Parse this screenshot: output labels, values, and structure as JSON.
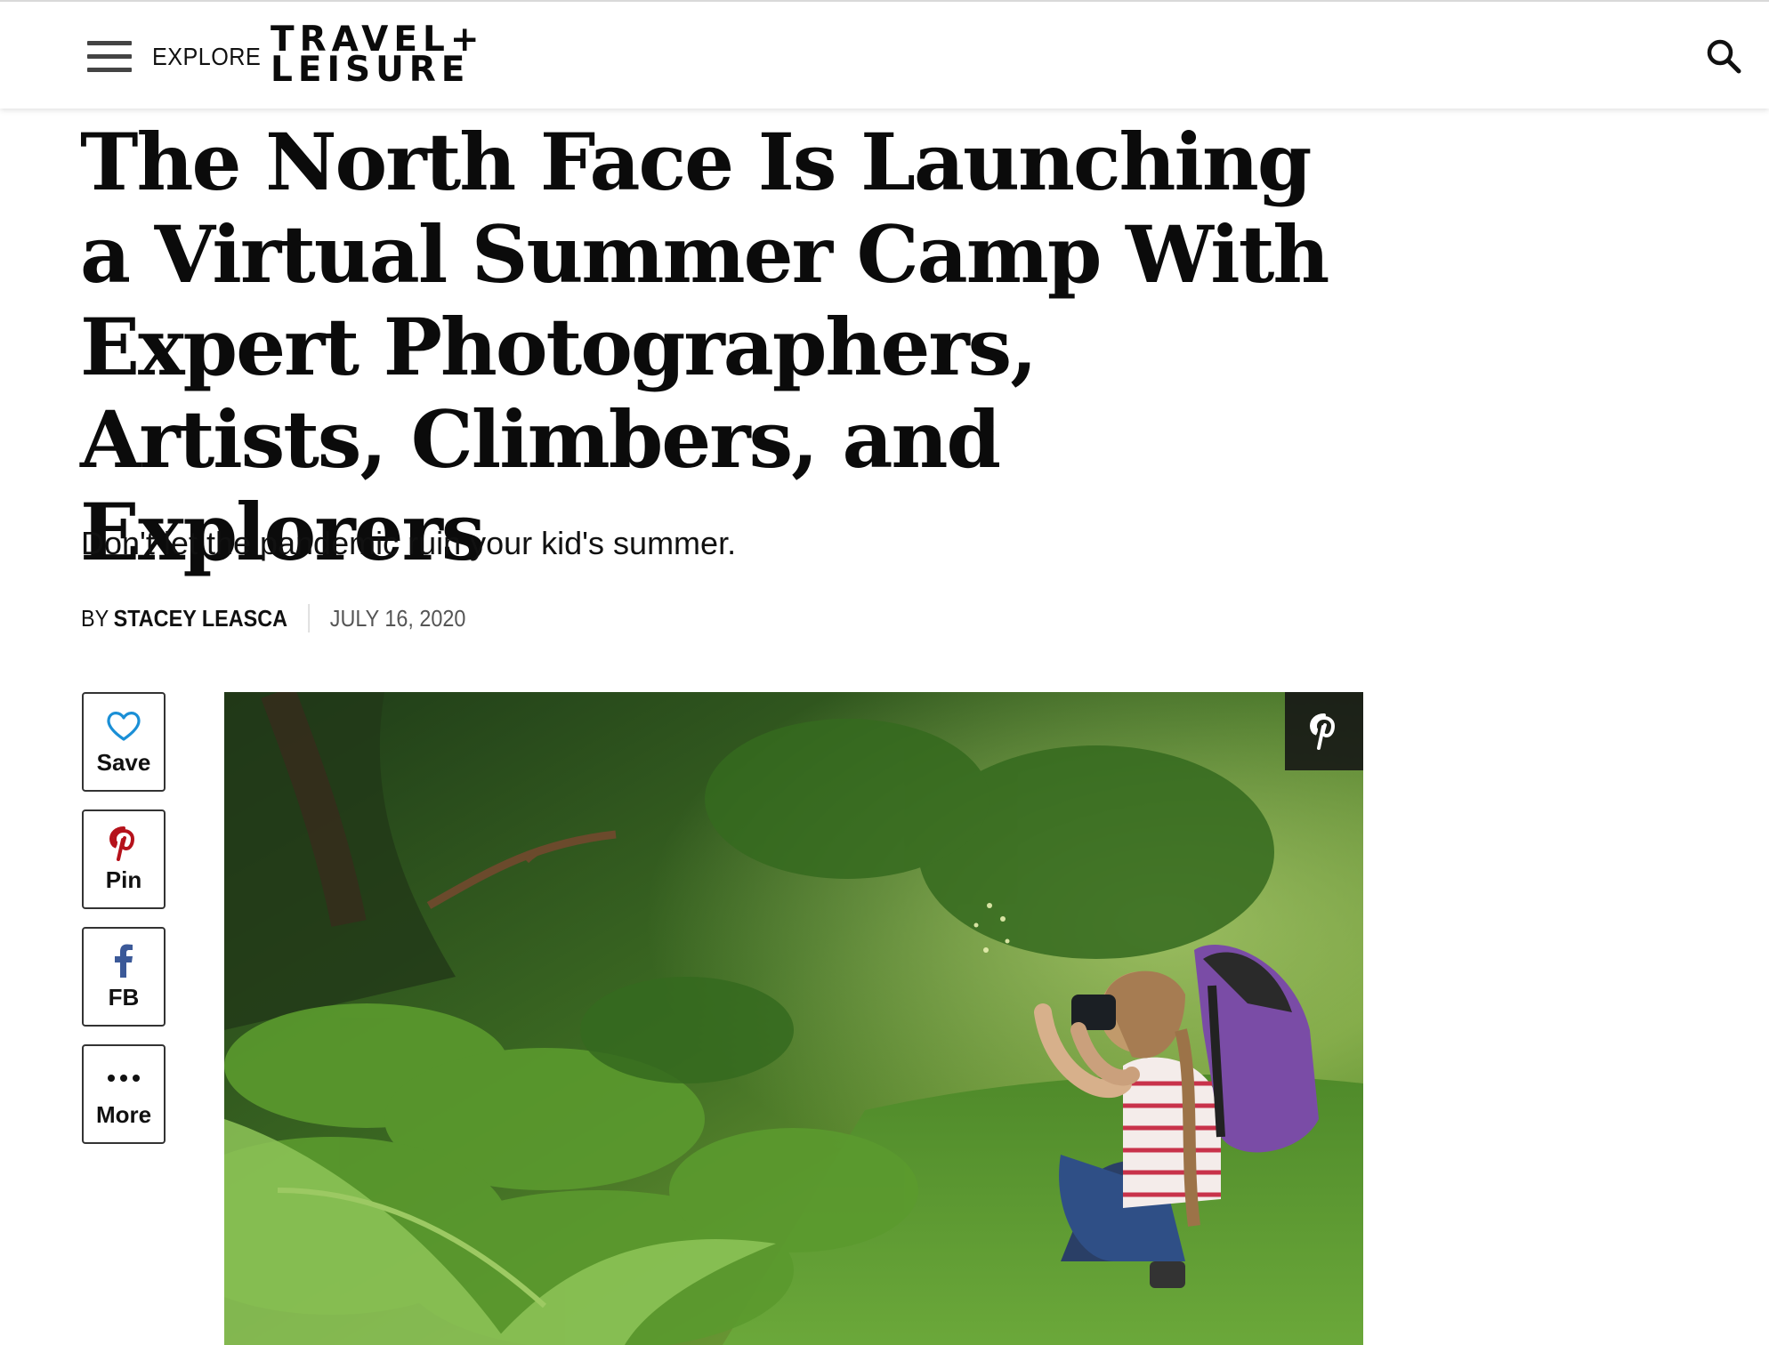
{
  "header": {
    "menu_label": "EXPLORE",
    "logo_line1": "TRAVEL+",
    "logo_line2": "LEISURE",
    "search_icon": "search-icon",
    "menu_icon": "hamburger-menu-icon"
  },
  "article": {
    "headline": "The North Face Is Launching a Virtual Summer Camp With Expert Photographers, Artists, Climbers, and Explorers",
    "dek": "Don't let the pandemic ruin your kid's summer.",
    "byline_prefix": "BY",
    "author": "STACEY LEASCA",
    "date": "JULY 16, 2020"
  },
  "share": {
    "buttons": [
      {
        "label": "Save",
        "icon": "heart-icon"
      },
      {
        "label": "Pin",
        "icon": "pinterest-icon"
      },
      {
        "label": "FB",
        "icon": "facebook-icon"
      },
      {
        "label": "More",
        "icon": "more-dots-icon"
      }
    ]
  },
  "hero_image": {
    "overlay_icon": "pinterest-icon"
  },
  "colors": {
    "save_icon": "#1a8fd6",
    "pin_icon": "#b5121b",
    "fb_icon": "#3b5998",
    "text": "#0b0b0b",
    "date": "#555555"
  }
}
